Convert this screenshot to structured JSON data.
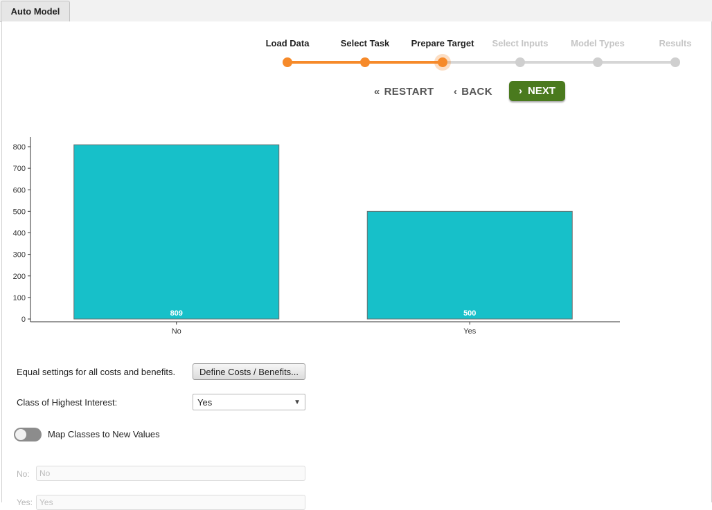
{
  "tab": {
    "label": "Auto Model"
  },
  "wizard": {
    "steps": [
      {
        "label": "Load Data",
        "state": "done"
      },
      {
        "label": "Select Task",
        "state": "done"
      },
      {
        "label": "Prepare Target",
        "state": "current"
      },
      {
        "label": "Select Inputs",
        "state": "todo"
      },
      {
        "label": "Model Types",
        "state": "todo"
      },
      {
        "label": "Results",
        "state": "todo"
      }
    ],
    "active_color": "#f68a2a",
    "inactive_color": "#d6d6d6"
  },
  "nav": {
    "restart_label": "RESTART",
    "restart_icon": "double-chevron-left-icon",
    "back_label": "BACK",
    "back_icon": "chevron-left-icon",
    "next_label": "NEXT",
    "next_icon": "chevron-right-icon",
    "next_color": "#4a7a1e"
  },
  "chart_data": {
    "type": "bar",
    "categories": [
      "No",
      "Yes"
    ],
    "values": [
      809,
      500
    ],
    "ylim": [
      0,
      800
    ],
    "yticks": [
      0,
      100,
      200,
      300,
      400,
      500,
      600,
      700,
      800
    ],
    "bar_color": "#17c0c9",
    "data_labels": true,
    "grid": false
  },
  "form": {
    "costs_text": "Equal settings for all costs and benefits.",
    "costs_button": "Define Costs / Benefits...",
    "interest_label": "Class of Highest Interest:",
    "interest_value": "Yes",
    "map_label": "Map Classes to New Values",
    "map_toggle_on": false,
    "mappings": [
      {
        "label": "No:",
        "placeholder": "No"
      },
      {
        "label": "Yes:",
        "placeholder": "Yes"
      }
    ]
  }
}
